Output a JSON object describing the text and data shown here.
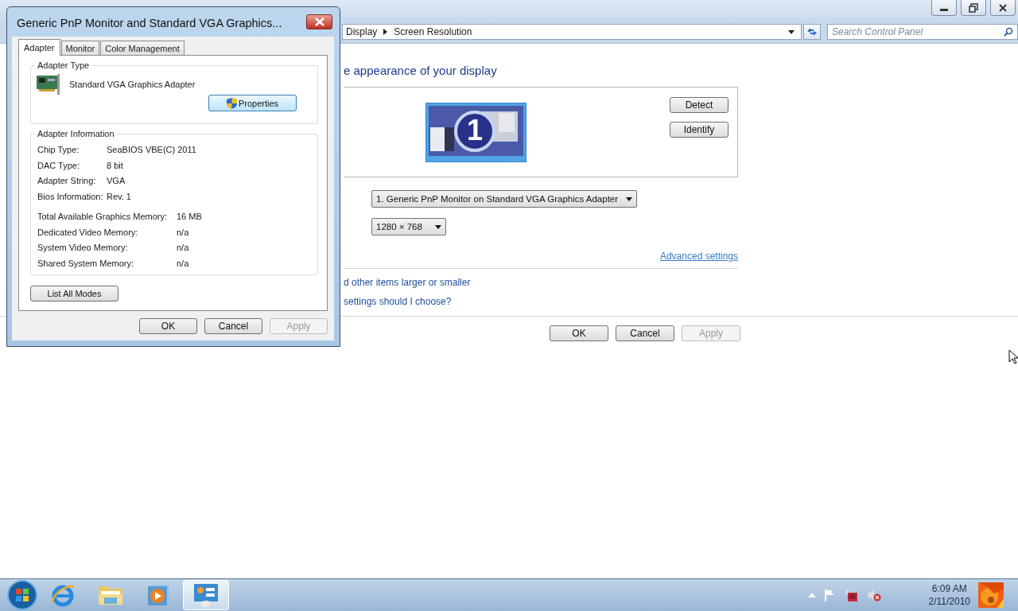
{
  "address_bar": {
    "breadcrumbs": [
      "Display",
      "Screen Resolution"
    ]
  },
  "search": {
    "placeholder": "Search Control Panel"
  },
  "heading": "e appearance of your display",
  "monitor_number": "1",
  "display_buttons": [
    "Detect",
    "Identify"
  ],
  "display_select": {
    "value": "1. Generic PnP Monitor on Standard VGA Graphics Adapter"
  },
  "resolution_select": {
    "value": "1280 × 768"
  },
  "advanced_link": "Advanced settings",
  "help_links": [
    "d other items larger or smaller",
    "settings should I choose?"
  ],
  "buttons": [
    {
      "label": "OK",
      "disabled": false
    },
    {
      "label": "Cancel",
      "disabled": false
    },
    {
      "label": "Apply",
      "disabled": true
    }
  ],
  "dialog": {
    "title": "Generic PnP Monitor and Standard VGA Graphics...",
    "tabs": [
      {
        "label": "Adapter",
        "selected": true
      },
      {
        "label": "Monitor",
        "selected": false
      },
      {
        "label": "Color Management",
        "selected": false
      }
    ],
    "adapter_type": {
      "heading": "Adapter Type",
      "name": "Standard VGA Graphics Adapter",
      "button": "Properties"
    },
    "adapter_info": {
      "heading": "Adapter Information",
      "rows": [
        {
          "label": "Chip Type:",
          "value": "SeaBIOS VBE(C) 2011"
        },
        {
          "label": "DAC Type:",
          "value": "8 bit"
        },
        {
          "label": "Adapter String:",
          "value": "VGA"
        },
        {
          "label": "Bios Information:",
          "value": "Rev. 1"
        }
      ],
      "memory_rows": [
        {
          "label": "Total Available Graphics Memory:",
          "value": "16 MB"
        },
        {
          "label": "Dedicated Video Memory:",
          "value": "n/a"
        },
        {
          "label": "System Video Memory:",
          "value": "n/a"
        },
        {
          "label": "Shared System Memory:",
          "value": "n/a"
        }
      ]
    },
    "list_modes_button": "List All Modes",
    "buttons": [
      {
        "label": "OK",
        "disabled": false
      },
      {
        "label": "Cancel",
        "disabled": false
      },
      {
        "label": "Apply",
        "disabled": true
      }
    ]
  },
  "taskbar": {
    "apps": [
      {
        "kind": "browser",
        "selected": false
      },
      {
        "kind": "folder",
        "selected": false
      },
      {
        "kind": "media",
        "selected": false
      },
      {
        "kind": "control",
        "selected": true
      }
    ],
    "clock": {
      "time": "6:09 AM",
      "date": "2/11/2010"
    }
  }
}
